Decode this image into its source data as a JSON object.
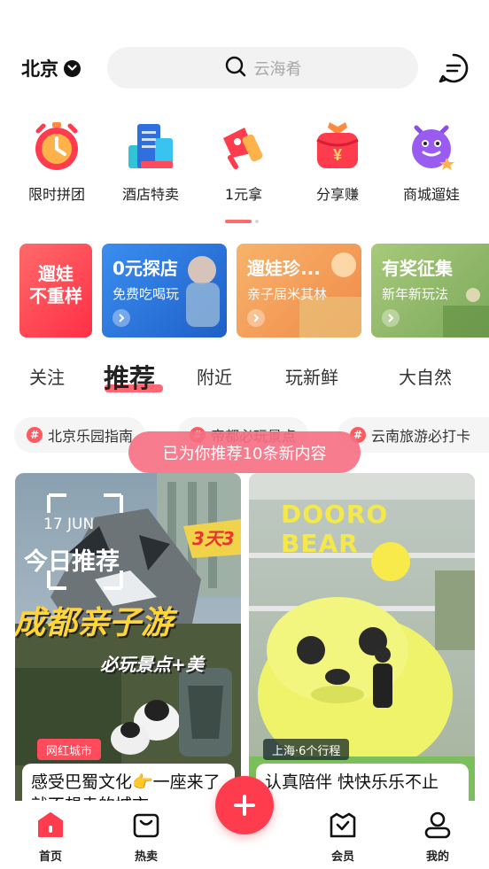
{
  "header": {
    "city": "北京",
    "search_placeholder": "云海肴",
    "icons": [
      "chevron-down-icon",
      "search-icon",
      "message-icon"
    ]
  },
  "quick_links": [
    {
      "label": "限时拼团",
      "icon": "alarm-clock-icon"
    },
    {
      "label": "酒店特卖",
      "icon": "hotel-building-icon"
    },
    {
      "label": "1元拿",
      "icon": "megaphone-icon"
    },
    {
      "label": "分享赚",
      "icon": "red-packet-icon"
    },
    {
      "label": "商城遛娃",
      "icon": "purple-monster-icon"
    }
  ],
  "banners": [
    {
      "title": "遛娃\n不重样",
      "subtitle": "",
      "color": "#ff3b4e"
    },
    {
      "title": "0元探店",
      "subtitle": "免费吃喝玩",
      "color": "#2f7fe0"
    },
    {
      "title": "遛娃珍...",
      "subtitle": "亲子届米其林",
      "color": "#f7a35a"
    },
    {
      "title": "有奖征集",
      "subtitle": "新年新玩法",
      "color": "#8cb86a"
    }
  ],
  "tabs": [
    {
      "label": "关注",
      "active": false
    },
    {
      "label": "推荐",
      "active": true
    },
    {
      "label": "附近",
      "active": false
    },
    {
      "label": "玩新鲜",
      "active": false
    },
    {
      "label": "大自然",
      "active": false
    }
  ],
  "topics": [
    {
      "label": "北京乐园指南"
    },
    {
      "label": "帝都必玩景点"
    },
    {
      "label": "云南旅游必打卡"
    }
  ],
  "toast": "已为你推荐10条新内容",
  "feed": [
    {
      "date_label": "17 JUN",
      "overlay_title": "今日推荐",
      "headline": "成都亲子游",
      "sub": "必玩景点+美",
      "corner_tag": "3天3",
      "badge": "网红城市",
      "caption": "感受巴蜀文化👉一座来了就不想走的城市"
    },
    {
      "sign": "DOORO BEAR",
      "badge": "上海·6个行程",
      "caption": "认真陪伴 快快乐乐不止"
    }
  ],
  "nav": [
    {
      "label": "首页",
      "icon": "home-icon",
      "active": true
    },
    {
      "label": "热卖",
      "icon": "shopping-bag-icon",
      "active": false
    },
    {
      "label": "会员",
      "icon": "member-bag-icon",
      "active": false
    },
    {
      "label": "我的",
      "icon": "user-icon",
      "active": false
    }
  ],
  "colors": {
    "accent": "#ff3b4e",
    "pager_active": "#ff6c6c"
  }
}
